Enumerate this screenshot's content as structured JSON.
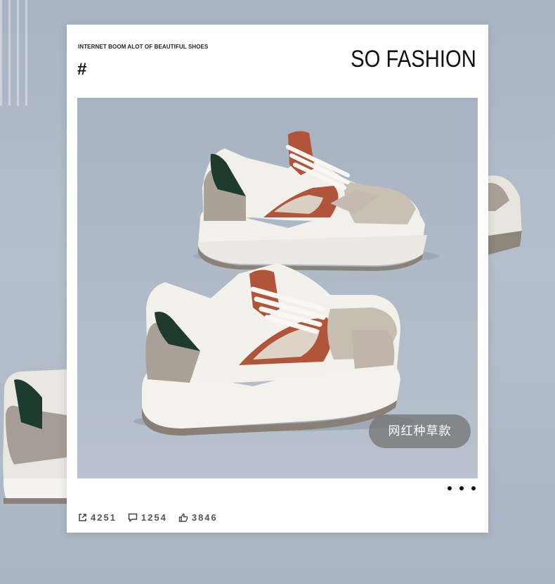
{
  "card": {
    "eyebrow": "INTERNET BOOM ALOT OF BEAUTIFUL SHOES",
    "hash": "#",
    "title": "SO FASHION",
    "tag": "网红种草款"
  },
  "stats": {
    "shares": "4251",
    "comments": "1254",
    "likes": "3846"
  },
  "icons": {
    "share": "share-icon",
    "comment": "comment-icon",
    "like": "thumbs-up-icon",
    "more": "more-dots-icon"
  },
  "colors": {
    "background": "#aab5c3",
    "card": "#ffffff",
    "tag_bg": "#707070",
    "brown": "#b0553a",
    "green": "#1f3b2f",
    "taupe": "#aaa197"
  }
}
